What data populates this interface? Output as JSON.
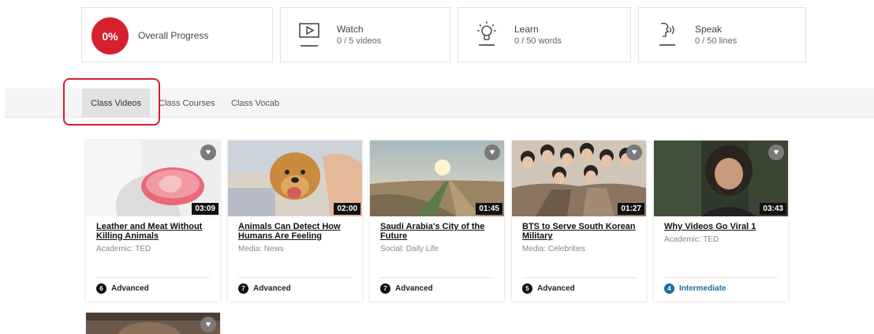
{
  "progress": {
    "overall": {
      "percent": "0%",
      "label": "Overall Progress",
      "color": "#d6202e"
    },
    "watch": {
      "label": "Watch",
      "sub": "0 / 5 videos",
      "icon": "video-play-icon"
    },
    "learn": {
      "label": "Learn",
      "sub": "0 / 50 words",
      "icon": "lightbulb-icon"
    },
    "speak": {
      "label": "Speak",
      "sub": "0 / 50 lines",
      "icon": "speaking-head-icon"
    }
  },
  "tabs": [
    {
      "label": "Class Videos",
      "active": true
    },
    {
      "label": "Class Courses",
      "active": false
    },
    {
      "label": "Class Vocab",
      "active": false
    }
  ],
  "videos": [
    {
      "title": "Leather and Meat Without Killing Animals",
      "category": "Academic: TED",
      "duration": "03:09",
      "level_num": "6",
      "level": "Advanced"
    },
    {
      "title": "Animals Can Detect How Humans Are Feeling",
      "category": "Media: News",
      "duration": "02:00",
      "level_num": "7",
      "level": "Advanced"
    },
    {
      "title": "Saudi Arabia's City of the Future",
      "category": "Social: Daily Life",
      "duration": "01:45",
      "level_num": "7",
      "level": "Advanced"
    },
    {
      "title": "BTS to Serve South Korean Military",
      "category": "Media: Celebrities",
      "duration": "01:27",
      "level_num": "5",
      "level": "Advanced"
    },
    {
      "title": "Why Videos Go Viral 1",
      "category": "Academic: TED",
      "duration": "03:43",
      "level_num": "4",
      "level": "Intermediate"
    }
  ],
  "colors": {
    "accent": "#d6202e",
    "intermediate": "#1b6fa3"
  }
}
